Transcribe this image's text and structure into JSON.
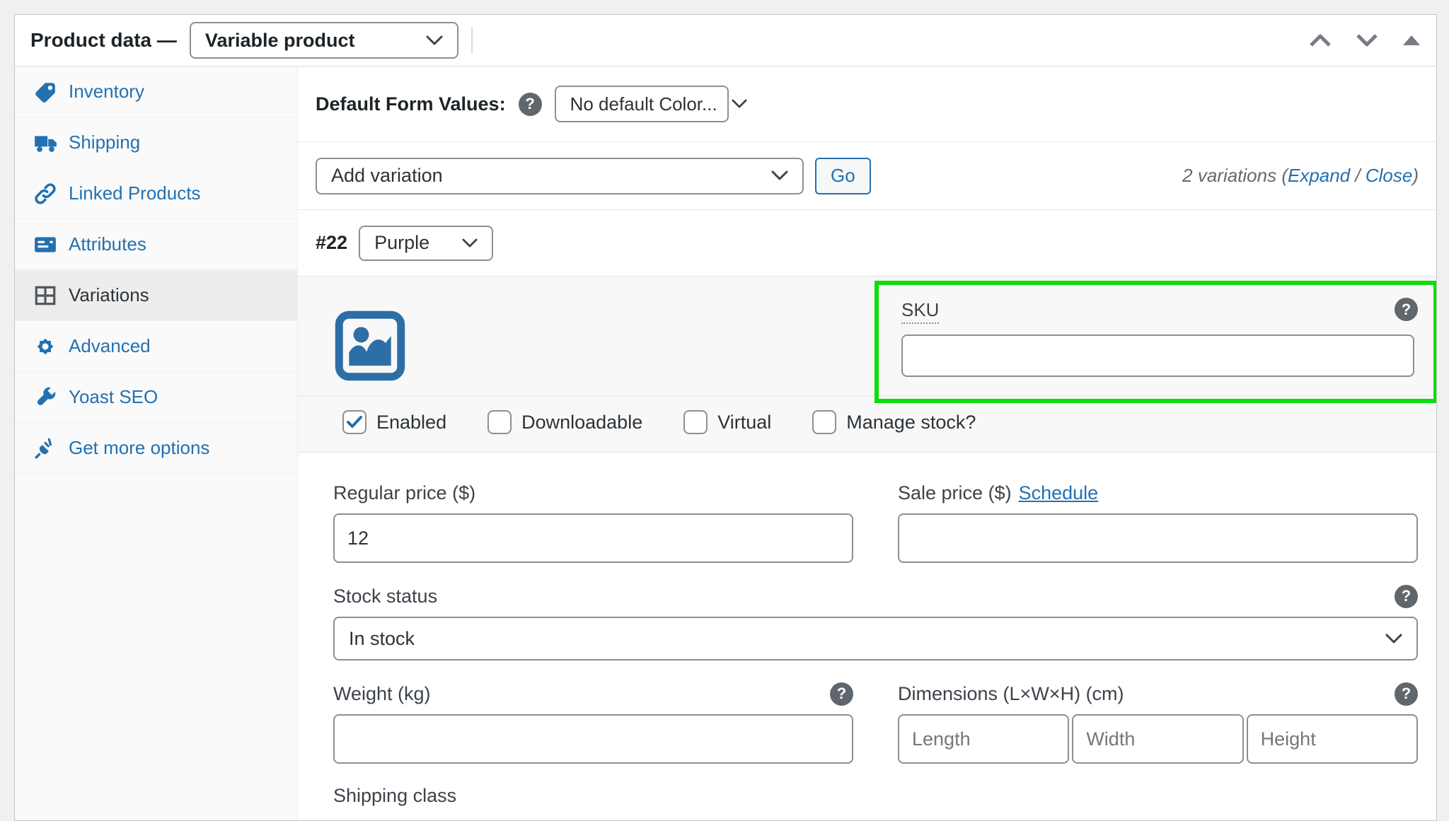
{
  "colors": {
    "accent_blue": "#2271B1",
    "highlight_green": "#0ADF0A",
    "image_icon_blue": "#2D6EA6",
    "active_tab_bg": "#EDEDED"
  },
  "header": {
    "title": "Product data —",
    "product_type": "Variable product"
  },
  "icons": {
    "help_glyph": "?"
  },
  "sidebar": {
    "items": [
      {
        "label": "Inventory",
        "icon": "tag-icon",
        "active": false
      },
      {
        "label": "Shipping",
        "icon": "truck-icon",
        "active": false
      },
      {
        "label": "Linked Products",
        "icon": "link-icon",
        "active": false
      },
      {
        "label": "Attributes",
        "icon": "card-icon",
        "active": false
      },
      {
        "label": "Variations",
        "icon": "grid-icon",
        "active": true
      },
      {
        "label": "Advanced",
        "icon": "gear-icon",
        "active": false
      },
      {
        "label": "Yoast SEO",
        "icon": "wrench-icon",
        "active": false
      },
      {
        "label": "Get more options",
        "icon": "plug-icon",
        "active": false
      }
    ]
  },
  "main": {
    "default_form_values": {
      "label": "Default Form Values:",
      "value": "No default Color..."
    },
    "toolbar": {
      "add_variation": "Add variation",
      "go": "Go",
      "summary_prefix": "2 variations (",
      "expand": "Expand",
      "separator": " / ",
      "close": "Close",
      "summary_suffix": ")"
    },
    "variation": {
      "id": "#22",
      "attribute": "Purple",
      "sku_label": "SKU",
      "checkboxes": [
        {
          "label": "Enabled",
          "checked": true
        },
        {
          "label": "Downloadable",
          "checked": false
        },
        {
          "label": "Virtual",
          "checked": false
        },
        {
          "label": "Manage stock?",
          "checked": false
        }
      ],
      "fields": {
        "regular_price_label": "Regular price ($)",
        "regular_price_value": "12",
        "sale_price_label": "Sale price ($)",
        "schedule_link": "Schedule",
        "stock_status_label": "Stock status",
        "stock_status_value": "In stock",
        "weight_label": "Weight (kg)",
        "dimensions_label": "Dimensions (L×W×H) (cm)",
        "length_placeholder": "Length",
        "width_placeholder": "Width",
        "height_placeholder": "Height",
        "shipping_class_label": "Shipping class"
      }
    }
  }
}
